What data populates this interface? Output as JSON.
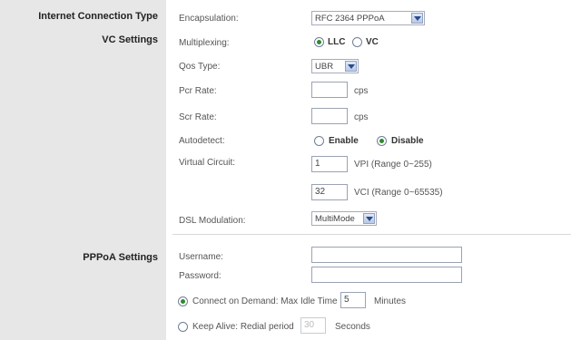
{
  "sections": {
    "internet_connection_type": "Internet Connection Type",
    "vc_settings": "VC Settings",
    "pppoa_settings": "PPPoA Settings"
  },
  "fields": {
    "encapsulation": {
      "label": "Encapsulation:",
      "value": "RFC 2364 PPPoA"
    },
    "multiplexing": {
      "label": "Multiplexing:",
      "options": [
        "LLC",
        "VC"
      ],
      "selected": "LLC"
    },
    "qos_type": {
      "label": "Qos Type:",
      "value": "UBR"
    },
    "pcr_rate": {
      "label": "Pcr Rate:",
      "value": "",
      "unit": "cps"
    },
    "scr_rate": {
      "label": "Scr Rate:",
      "value": "",
      "unit": "cps"
    },
    "autodetect": {
      "label": "Autodetect:",
      "options": [
        "Enable",
        "Disable"
      ],
      "selected": "Disable"
    },
    "virtual_circuit": {
      "label": "Virtual Circuit:",
      "vpi": "1",
      "vpi_hint": "VPI (Range 0~255)",
      "vci": "32",
      "vci_hint": "VCI (Range 0~65535)"
    },
    "dsl_modulation": {
      "label": "DSL Modulation:",
      "value": "MultiMode"
    },
    "username": {
      "label": "Username:",
      "value": ""
    },
    "password": {
      "label": "Password:",
      "value": ""
    },
    "connect_on_demand": {
      "label": "Connect on Demand: Max Idle Time",
      "value": "5",
      "unit": "Minutes",
      "selected": true
    },
    "keep_alive": {
      "label": "Keep Alive: Redial period",
      "value": "30",
      "unit": "Seconds",
      "selected": false
    }
  },
  "colors": {
    "left_panel": "#e7e7e7",
    "radio_selected": "#2d8a2d"
  }
}
